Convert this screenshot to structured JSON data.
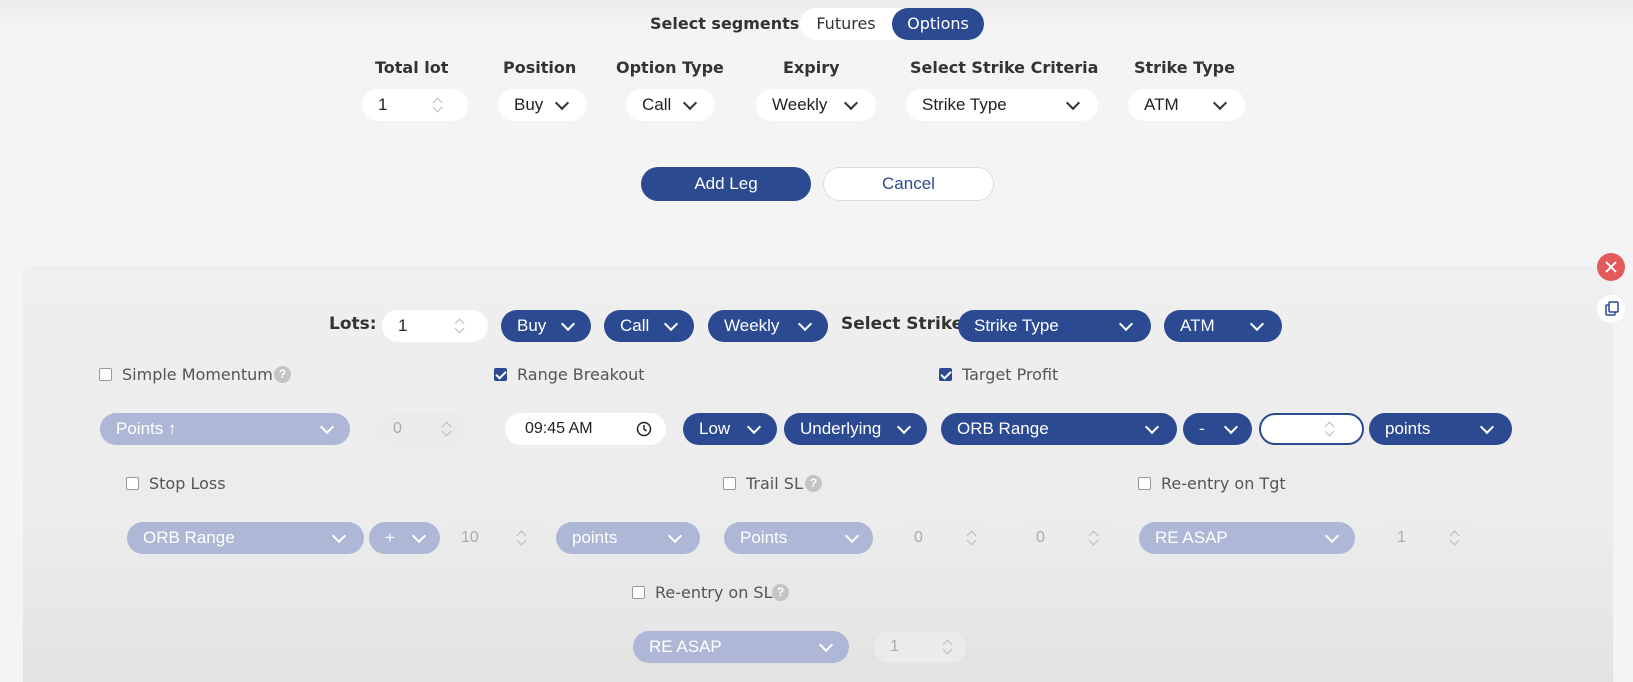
{
  "segments": {
    "label": "Select segments",
    "options": [
      "Futures",
      "Options"
    ],
    "selected": "Options"
  },
  "legform": {
    "total_lot": {
      "label": "Total lot",
      "value": "1"
    },
    "position": {
      "label": "Position",
      "value": "Buy"
    },
    "option_type": {
      "label": "Option Type",
      "value": "Call"
    },
    "expiry": {
      "label": "Expiry",
      "value": "Weekly"
    },
    "strike_criteria": {
      "label": "Select Strike Criteria",
      "value": "Strike Type"
    },
    "strike_type": {
      "label": "Strike Type",
      "value": "ATM"
    },
    "add_leg": "Add Leg",
    "cancel": "Cancel"
  },
  "leg": {
    "lots_label": "Lots:",
    "lots_value": "1",
    "position": "Buy",
    "option_type": "Call",
    "expiry": "Weekly",
    "select_strike_label": "Select Strike",
    "strike_criteria": "Strike Type",
    "strike_type": "ATM",
    "simple_momentum": {
      "label": "Simple Momentum",
      "checked": false,
      "mode": "Points ↑",
      "value": "0"
    },
    "range_breakout": {
      "label": "Range Breakout",
      "checked": true,
      "time": "09:45 AM",
      "side": "Low",
      "source": "Underlying"
    },
    "target_profit": {
      "label": "Target Profit",
      "checked": true,
      "basis": "ORB Range",
      "sign": "-",
      "value": "",
      "unit": "points"
    },
    "stop_loss": {
      "label": "Stop Loss",
      "checked": false,
      "basis": "ORB Range",
      "sign": "+",
      "value": "10",
      "unit": "points"
    },
    "trail_sl": {
      "label": "Trail SL",
      "checked": false,
      "mode": "Points",
      "x": "0",
      "y": "0"
    },
    "reentry_tgt": {
      "label": "Re-entry on Tgt",
      "checked": false,
      "mode": "RE ASAP",
      "count": "1"
    },
    "reentry_sl": {
      "label": "Re-entry on SL",
      "checked": false,
      "mode": "RE ASAP",
      "count": "1"
    }
  },
  "help_glyph": "?",
  "colors": {
    "primary": "#2c4a92",
    "disabled": "#aeb8d6",
    "danger": "#e25a5a"
  },
  "icons": [
    "chevron-down-icon",
    "spinner-icon",
    "clock-icon",
    "help-icon",
    "close-icon",
    "copy-icon"
  ]
}
